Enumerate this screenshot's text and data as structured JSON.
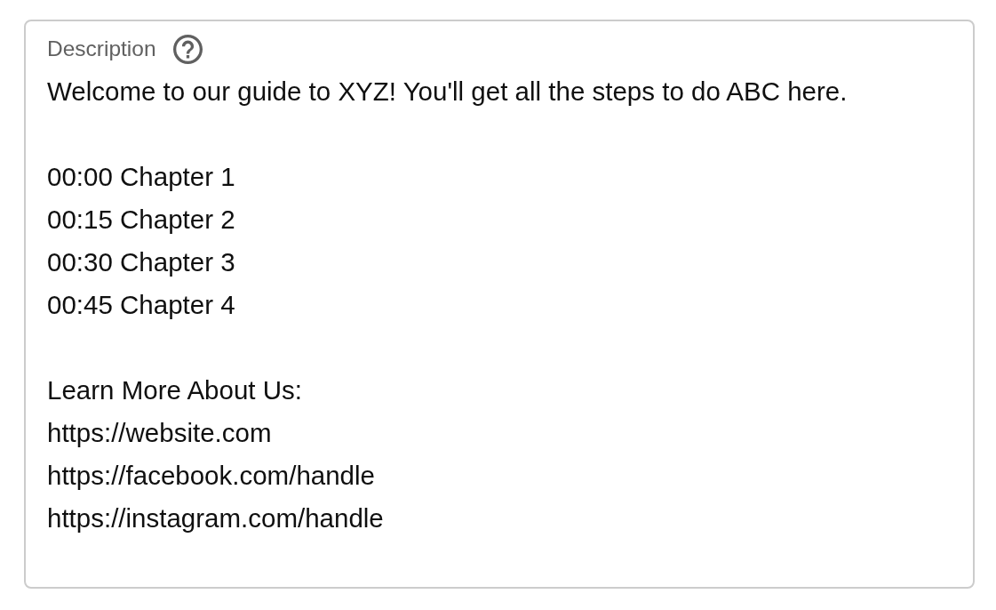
{
  "description_field": {
    "label": "Description",
    "paragraphs": [
      [
        "Welcome to our guide to XYZ! You'll get all the steps to do ABC here."
      ],
      [
        "00:00 Chapter 1",
        "00:15 Chapter 2",
        "00:30 Chapter 3",
        "00:45 Chapter 4"
      ],
      [
        "Learn More About Us:",
        "https://website.com",
        "https://facebook.com/handle",
        "https://instagram.com/handle"
      ]
    ]
  }
}
